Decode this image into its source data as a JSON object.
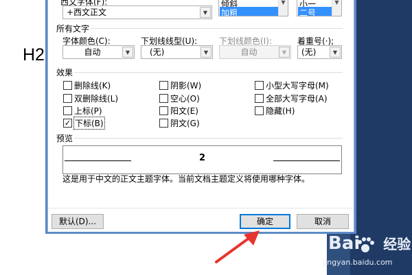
{
  "background": {
    "heading_text": "H2",
    "watermark_brand": "Bai",
    "watermark_suffix": "经验",
    "watermark_url": "jingyan.baidu.com"
  },
  "font_section": {
    "western_font_label": "西文字体(F):",
    "western_font_value": "+西文正文",
    "style_list": {
      "items": [
        "倾斜",
        "加粗"
      ],
      "selected_index": 1
    },
    "size_list": {
      "items": [
        "小一",
        "二号"
      ],
      "selected_index": 1
    }
  },
  "all_text": {
    "group_title": "所有文字",
    "font_color_label": "字体颜色(C):",
    "font_color_value": "自动",
    "underline_style_label": "下划线线型(U):",
    "underline_style_value": "(无)",
    "underline_color_label": "下划线颜色(I):",
    "underline_color_value": "自动",
    "emphasis_label": "着重号(·);",
    "emphasis_value": "(无)"
  },
  "effects": {
    "group_title": "效果",
    "col1": [
      {
        "label": "删除线(K)",
        "checked": false
      },
      {
        "label": "双删除线(L)",
        "checked": false
      },
      {
        "label": "上标(P)",
        "checked": false
      },
      {
        "label": "下标(B)",
        "checked": true
      }
    ],
    "col2": [
      {
        "label": "阴影(W)",
        "checked": false
      },
      {
        "label": "空心(O)",
        "checked": false
      },
      {
        "label": "阳文(E)",
        "checked": false
      },
      {
        "label": "阴文(G)",
        "checked": false
      }
    ],
    "col3": [
      {
        "label": "小型大写字母(M)",
        "checked": false
      },
      {
        "label": "全部大写字母(A)",
        "checked": false
      },
      {
        "label": "隐藏(H)",
        "checked": false
      }
    ]
  },
  "preview": {
    "group_title": "预览",
    "sample_text": "2",
    "description": "这是用于中文的正文主题字体。当前文档主题定义将使用哪种字体。"
  },
  "buttons": {
    "default_label": "默认(D)...",
    "ok_label": "确定",
    "cancel_label": "取消"
  },
  "colors": {
    "accent": "#0078d7",
    "annotation_arrow": "#e8342f",
    "selection": "#3390ff"
  }
}
